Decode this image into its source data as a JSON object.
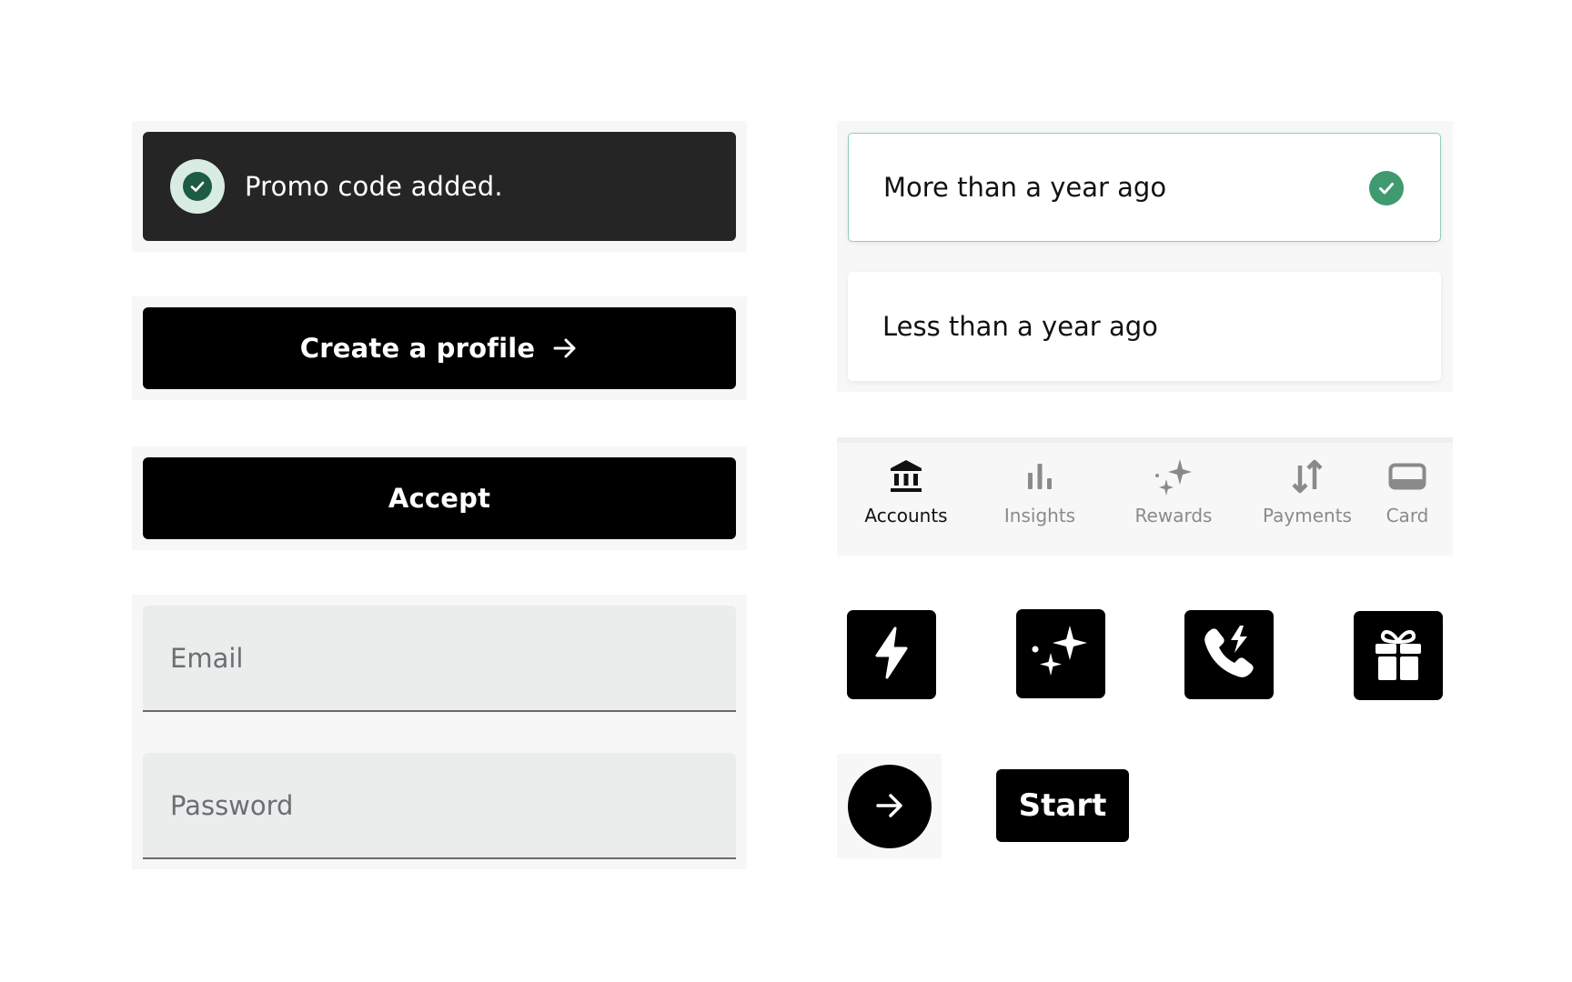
{
  "toast": {
    "message": "Promo code added.",
    "icon": "check-circle-icon"
  },
  "create_profile": {
    "label": "Create a profile",
    "icon": "arrow-right-icon"
  },
  "accept": {
    "label": "Accept"
  },
  "form": {
    "email_placeholder": "Email",
    "password_placeholder": "Password"
  },
  "options": [
    {
      "label": "More than a year ago",
      "selected": true
    },
    {
      "label": "Less than a year ago",
      "selected": false
    }
  ],
  "tabs": [
    {
      "label": "Accounts",
      "icon": "bank-icon",
      "active": true
    },
    {
      "label": "Insights",
      "icon": "bar-chart-icon",
      "active": false
    },
    {
      "label": "Rewards",
      "icon": "sparkles-icon",
      "active": false
    },
    {
      "label": "Payments",
      "icon": "transfer-arrows-icon",
      "active": false
    },
    {
      "label": "Card",
      "icon": "card-icon",
      "active": false
    }
  ],
  "icon_tiles": [
    "lightning-icon",
    "sparkles-icon",
    "phone-bolt-icon",
    "gift-icon"
  ],
  "circle_button": {
    "icon": "arrow-right-icon"
  },
  "start": {
    "label": "Start"
  },
  "colors": {
    "toast_bg": "#252525",
    "accent_green": "#3f9a6f",
    "selected_border": "#8fcfbf",
    "primary": "#000000",
    "inactive_tab": "#8a8a8a"
  }
}
